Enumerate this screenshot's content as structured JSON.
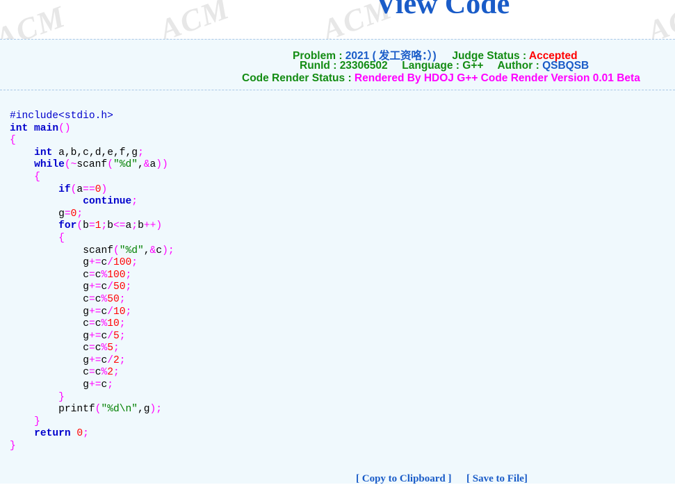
{
  "header": {
    "title": "View Code",
    "watermark": "ACM"
  },
  "info": {
    "problem_label": "Problem :",
    "problem_value": "2021 ( 发工资咯：）)",
    "judge_status_label": "Judge Status :",
    "judge_status_value": "Accepted",
    "runid_label": "RunId :",
    "runid_value": "23306502",
    "language_label": "Language :",
    "language_value": "G++",
    "author_label": "Author :",
    "author_value": "QSBQSB",
    "render_label": "Code Render Status :",
    "render_value": "Rendered By HDOJ G++ Code Render Version 0.01 Beta"
  },
  "code": {
    "lines": [
      "#include<stdio.h>",
      "int main()",
      "{",
      "    int a,b,c,d,e,f,g;",
      "    while(~scanf(\"%d\",&a))",
      "    {",
      "        if(a==0)",
      "            continue;",
      "        g=0;",
      "        for(b=1;b<=a;b++)",
      "        {",
      "            scanf(\"%d\",&c);",
      "            g+=c/100;",
      "            c=c%100;",
      "            g+=c/50;",
      "            c=c%50;",
      "            g+=c/10;",
      "            c=c%10;",
      "            g+=c/5;",
      "            c=c%5;",
      "            g+=c/2;",
      "            c=c%2;",
      "            g+=c;",
      "        }",
      "        printf(\"%d\\n\",g);",
      "    }",
      "    return 0;",
      "}"
    ]
  },
  "footer": {
    "copy_label": "[ Copy to Clipboard ]",
    "save_label": "[ Save to File]"
  },
  "colors": {
    "title": "#1a5cc8",
    "label": "#138c13",
    "value": "#1a5cc8",
    "accepted": "#ff0000",
    "render_status": "#ff00ff",
    "panel_background": "#f0f9fd",
    "keyword": "#0000cc",
    "operator": "#ff00ff",
    "number": "#ff0000",
    "string": "#008000"
  }
}
